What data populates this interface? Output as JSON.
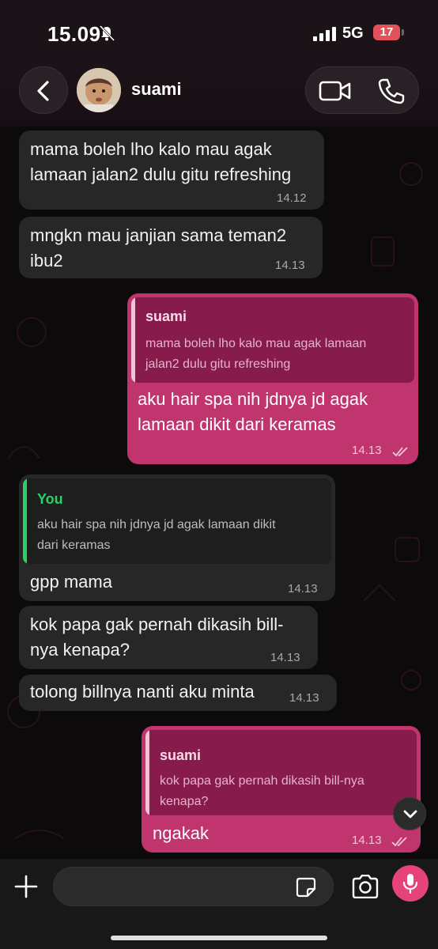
{
  "status_bar": {
    "time": "15.09",
    "network": "5G",
    "battery": "17"
  },
  "header": {
    "contact_name": "suami"
  },
  "messages": [
    {
      "type": "incoming",
      "lines": [
        "mama boleh lho kalo mau agak",
        "lamaan jalan2 dulu gitu refreshing"
      ],
      "time": "14.12"
    },
    {
      "type": "incoming",
      "lines": [
        "mngkn mau janjian sama teman2",
        "ibu2"
      ],
      "time": "14.13"
    },
    {
      "type": "outgoing",
      "quote": {
        "name": "suami",
        "lines": [
          "mama boleh lho kalo mau agak lamaan",
          "jalan2 dulu gitu refreshing"
        ]
      },
      "lines": [
        "aku hair spa nih jdnya jd agak",
        "lamaan dikit dari keramas"
      ],
      "time": "14.13"
    },
    {
      "type": "incoming",
      "quote": {
        "name": "You",
        "lines": [
          "aku hair spa nih jdnya jd agak lamaan dikit",
          "dari keramas"
        ]
      },
      "lines": [
        "gpp mama"
      ],
      "time": "14.13"
    },
    {
      "type": "incoming",
      "lines": [
        "kok papa gak pernah dikasih bill-",
        "nya kenapa?"
      ],
      "time": "14.13"
    },
    {
      "type": "incoming",
      "lines": [
        "tolong billnya nanti aku minta"
      ],
      "time": "14.13"
    },
    {
      "type": "outgoing",
      "quote": {
        "name": "suami",
        "lines": [
          "kok papa gak pernah dikasih bill-nya",
          "kenapa?"
        ]
      },
      "lines": [
        "ngakak"
      ],
      "time": "14.13"
    }
  ],
  "input": {
    "placeholder": ""
  },
  "colors": {
    "outgoing_bubble": "#c0356d",
    "incoming_bubble": "#272727",
    "you_name": "#25d366",
    "accent": "#e6437a"
  },
  "icons": [
    "back-arrow-icon",
    "video-call-icon",
    "phone-icon",
    "plus-icon",
    "sticker-icon",
    "camera-icon",
    "mic-icon",
    "chevron-down-icon",
    "mute-bell-icon",
    "signal-icon"
  ]
}
